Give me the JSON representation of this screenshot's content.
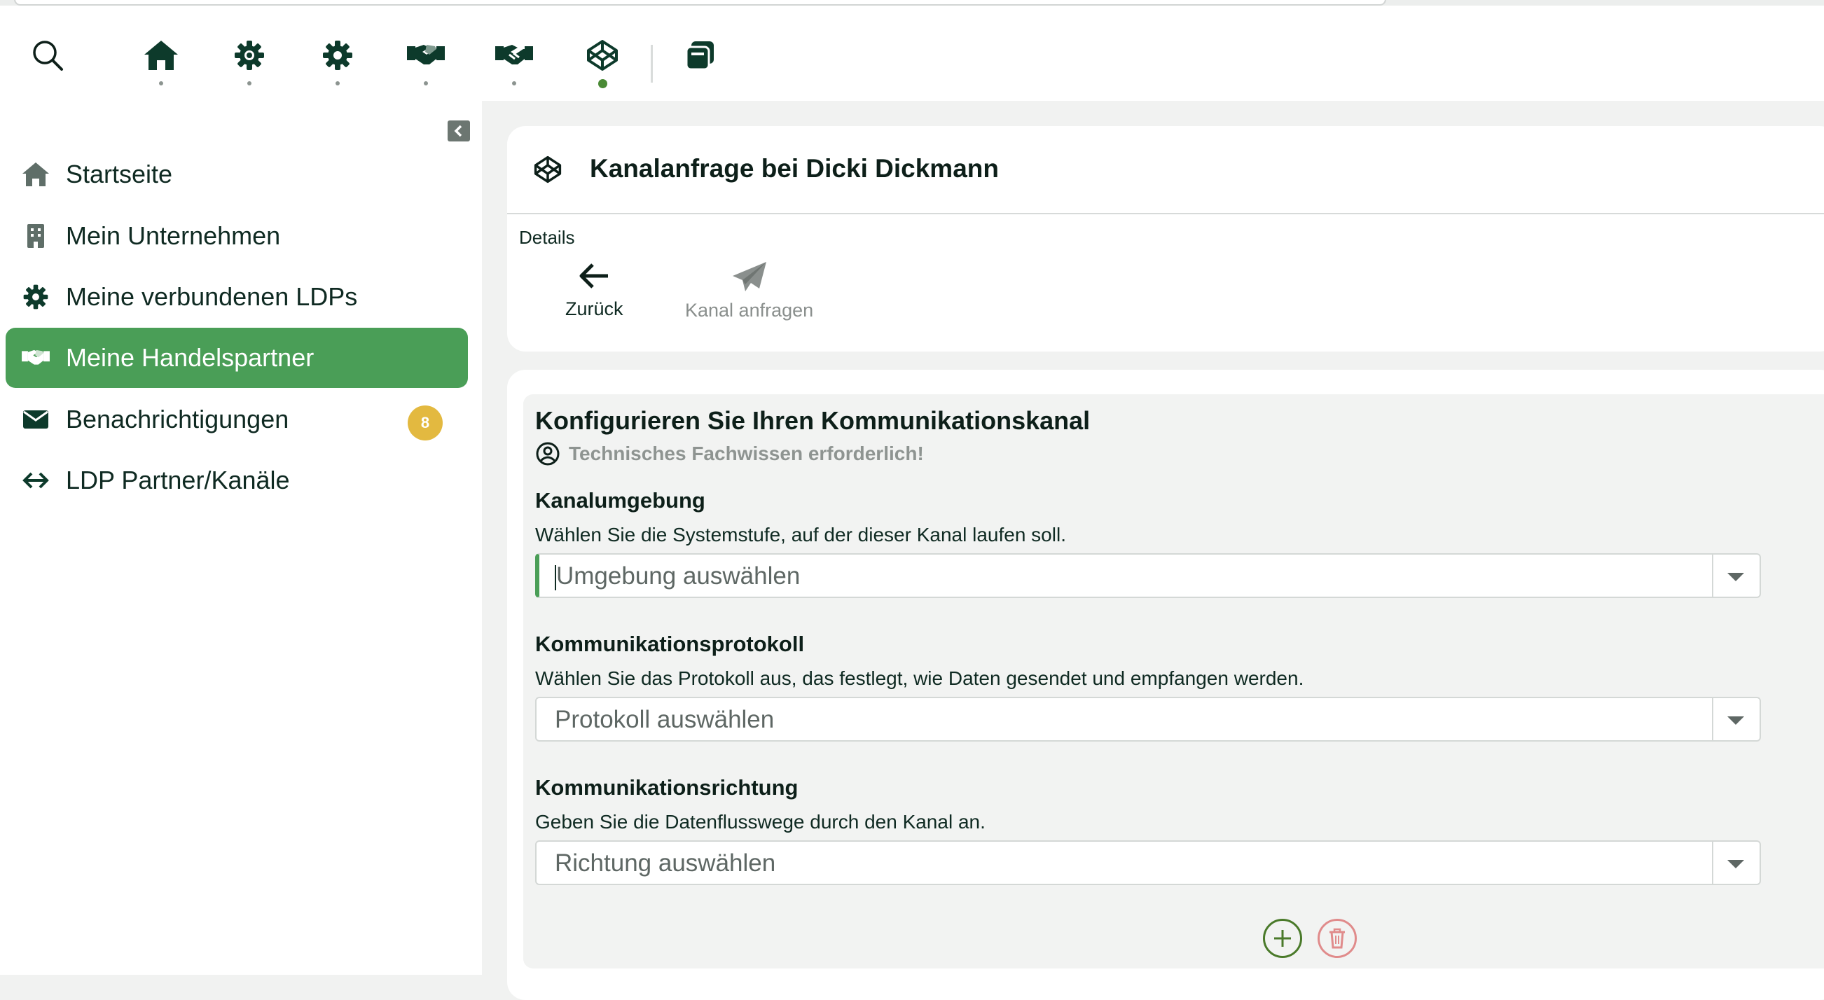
{
  "topnav": {
    "items": [
      {
        "name": "search-icon"
      },
      {
        "name": "home-icon"
      },
      {
        "name": "gear-cog-icon"
      },
      {
        "name": "gear-icon"
      },
      {
        "name": "handshake-icon"
      },
      {
        "name": "handshake-outline-icon"
      },
      {
        "name": "cube-icon",
        "active": true
      },
      {
        "name": "documents-icon"
      }
    ]
  },
  "sidebar": {
    "items": [
      {
        "label": "Startseite",
        "icon": "home-icon"
      },
      {
        "label": "Mein Unternehmen",
        "icon": "building-icon"
      },
      {
        "label": "Meine verbundenen LDPs",
        "icon": "gear-icon"
      },
      {
        "label": "Meine Handelspartner",
        "icon": "handshake-icon",
        "active": true
      },
      {
        "label": "Benachrichtigungen",
        "icon": "envelope-icon",
        "badge": "8"
      },
      {
        "label": "LDP Partner/Kanäle",
        "icon": "arrows-icon"
      }
    ]
  },
  "header": {
    "title": "Kanalanfrage bei Dicki Dickmann",
    "details_label": "Details",
    "actions": {
      "back": "Zurück",
      "request": "Kanal anfragen"
    }
  },
  "form": {
    "title": "Konfigurieren Sie Ihren Kommunikationskanal",
    "warning": "Technisches Fachwissen erforderlich!",
    "fields": [
      {
        "title": "Kanalumgebung",
        "description": "Wählen Sie die Systemstufe, auf der dieser Kanal laufen soll.",
        "placeholder": "Umgebung auswählen"
      },
      {
        "title": "Kommunikationsprotokoll",
        "description": "Wählen Sie das Protokoll aus, das festlegt, wie Daten gesendet und empfangen werden.",
        "placeholder": "Protokoll auswählen"
      },
      {
        "title": "Kommunikationsrichtung",
        "description": "Geben Sie die Datenflusswege durch den Kanal an.",
        "placeholder": "Richtung auswählen"
      }
    ]
  },
  "colors": {
    "accent": "#4a9e57",
    "active_dot": "#4a8a35",
    "badge": "#e3b940",
    "delete": "#e08b8b",
    "text": "#0f2a22"
  }
}
